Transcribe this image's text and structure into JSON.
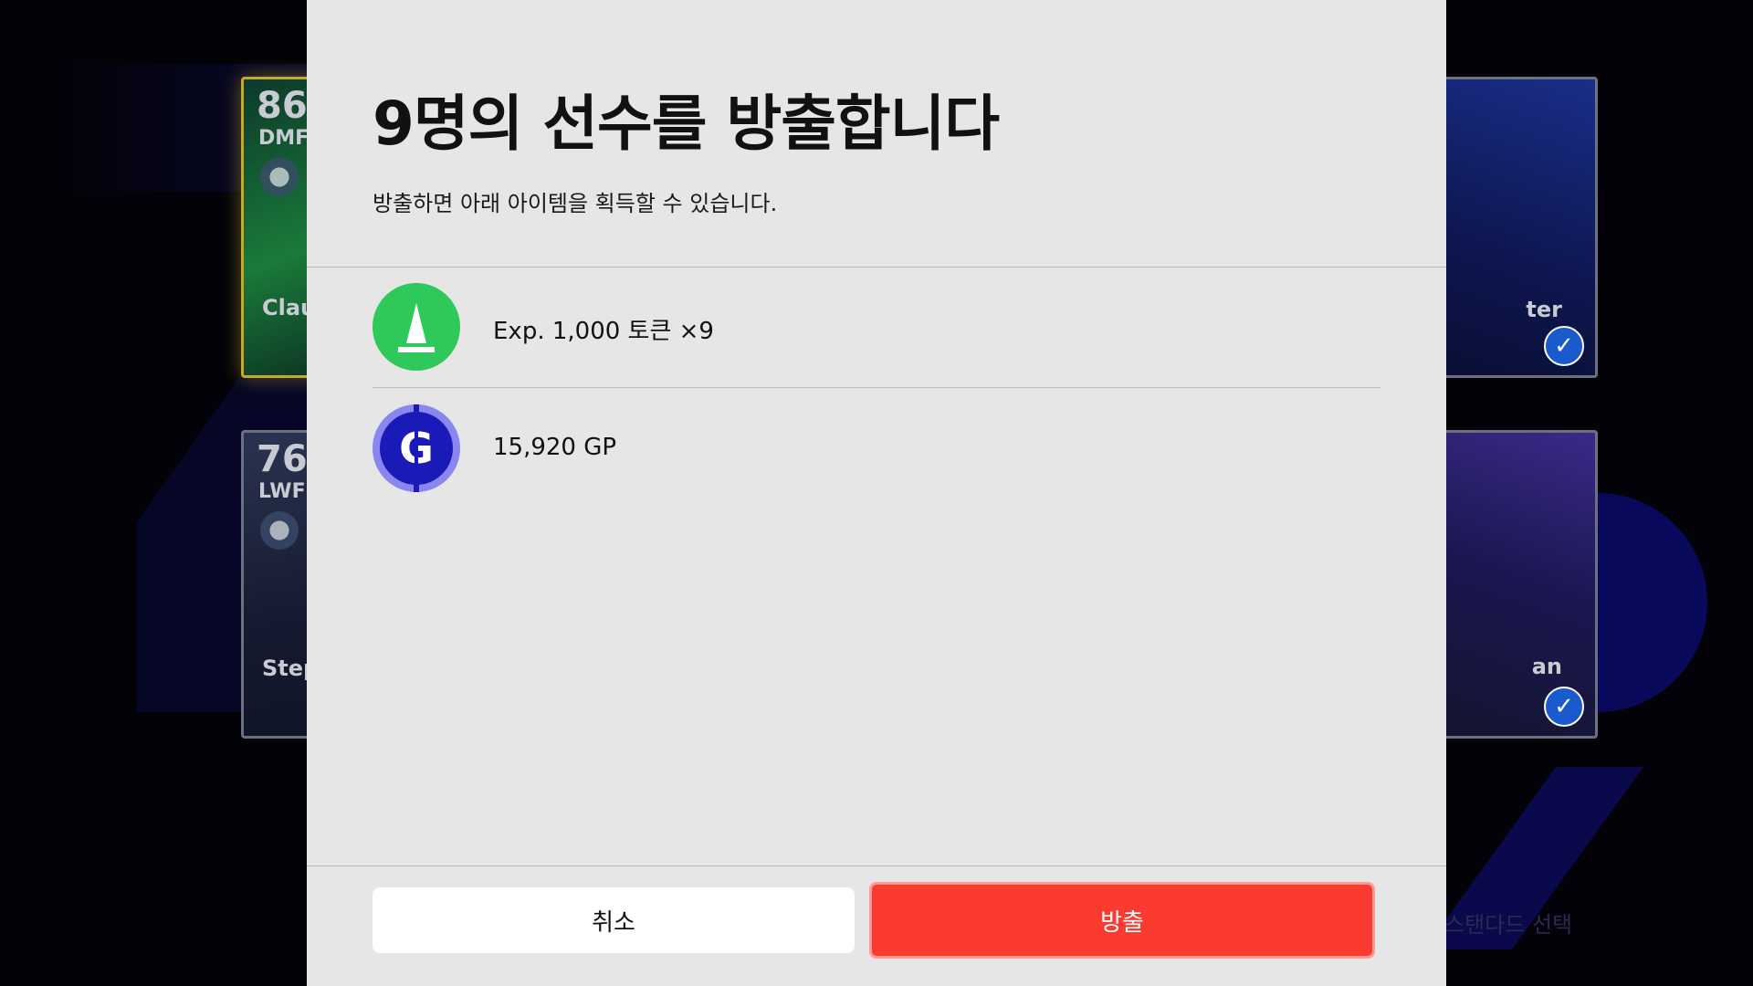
{
  "background": {
    "cards": [
      {
        "rating": "86",
        "position": "DMF",
        "name": "Clau"
      },
      {
        "rating": "76",
        "position": "LWF",
        "name": "Step"
      },
      {
        "rating": "",
        "position": "",
        "name": "ter"
      },
      {
        "rating": "",
        "position": "",
        "name": "an"
      }
    ],
    "standard_label": "스탠다드 선택"
  },
  "modal": {
    "title": "9명의 선수를 방출합니다",
    "subtitle": "방출하면 아래 아이템을 획득할 수 있습니다.",
    "rewards": [
      {
        "icon": "training-cone-icon",
        "label": "Exp. 1,000 토큰 ×9"
      },
      {
        "icon": "gp-coin-icon",
        "label": "15,920 GP"
      }
    ],
    "buttons": {
      "cancel": "취소",
      "release": "방출"
    }
  },
  "colors": {
    "release_button": "#fb3b30",
    "cone_icon_bg": "#2ec95a",
    "gp_icon_bg": "#8a86f0"
  }
}
